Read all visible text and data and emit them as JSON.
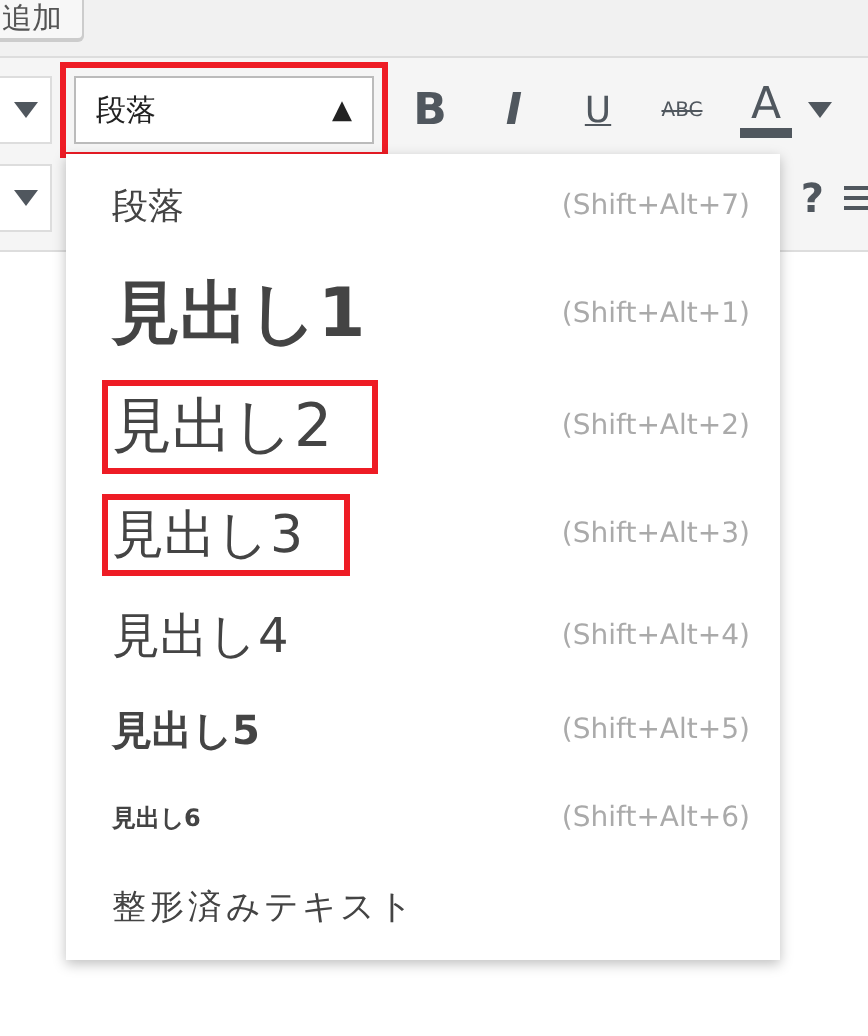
{
  "top_button": {
    "label": "追加"
  },
  "toolbar": {
    "format_select": {
      "value": "段落",
      "caret": "▲",
      "highlighted": true
    },
    "buttons": [
      {
        "kind": "bold",
        "label": "B"
      },
      {
        "kind": "italic",
        "label": "I"
      },
      {
        "kind": "underline",
        "label": "U"
      },
      {
        "kind": "strike",
        "label": "ABC"
      },
      {
        "kind": "color",
        "label": "A"
      }
    ],
    "row2_right": "?"
  },
  "format_menu": {
    "items": [
      {
        "kind": "p",
        "label": "段落",
        "shortcut": "(Shift+Alt+7)",
        "highlighted": false
      },
      {
        "kind": "h1",
        "label": "見出し1",
        "shortcut": "(Shift+Alt+1)",
        "highlighted": false
      },
      {
        "kind": "h2",
        "label": "見出し2",
        "shortcut": "(Shift+Alt+2)",
        "highlighted": true
      },
      {
        "kind": "h3",
        "label": "見出し3",
        "shortcut": "(Shift+Alt+3)",
        "highlighted": true
      },
      {
        "kind": "h4",
        "label": "見出し4",
        "shortcut": "(Shift+Alt+4)",
        "highlighted": false
      },
      {
        "kind": "h5",
        "label": "見出し5",
        "shortcut": "(Shift+Alt+5)",
        "highlighted": false
      },
      {
        "kind": "h6",
        "label": "見出し6",
        "shortcut": "(Shift+Alt+6)",
        "highlighted": false
      },
      {
        "kind": "pre",
        "label": "整形済みテキスト",
        "highlighted": false
      }
    ]
  }
}
